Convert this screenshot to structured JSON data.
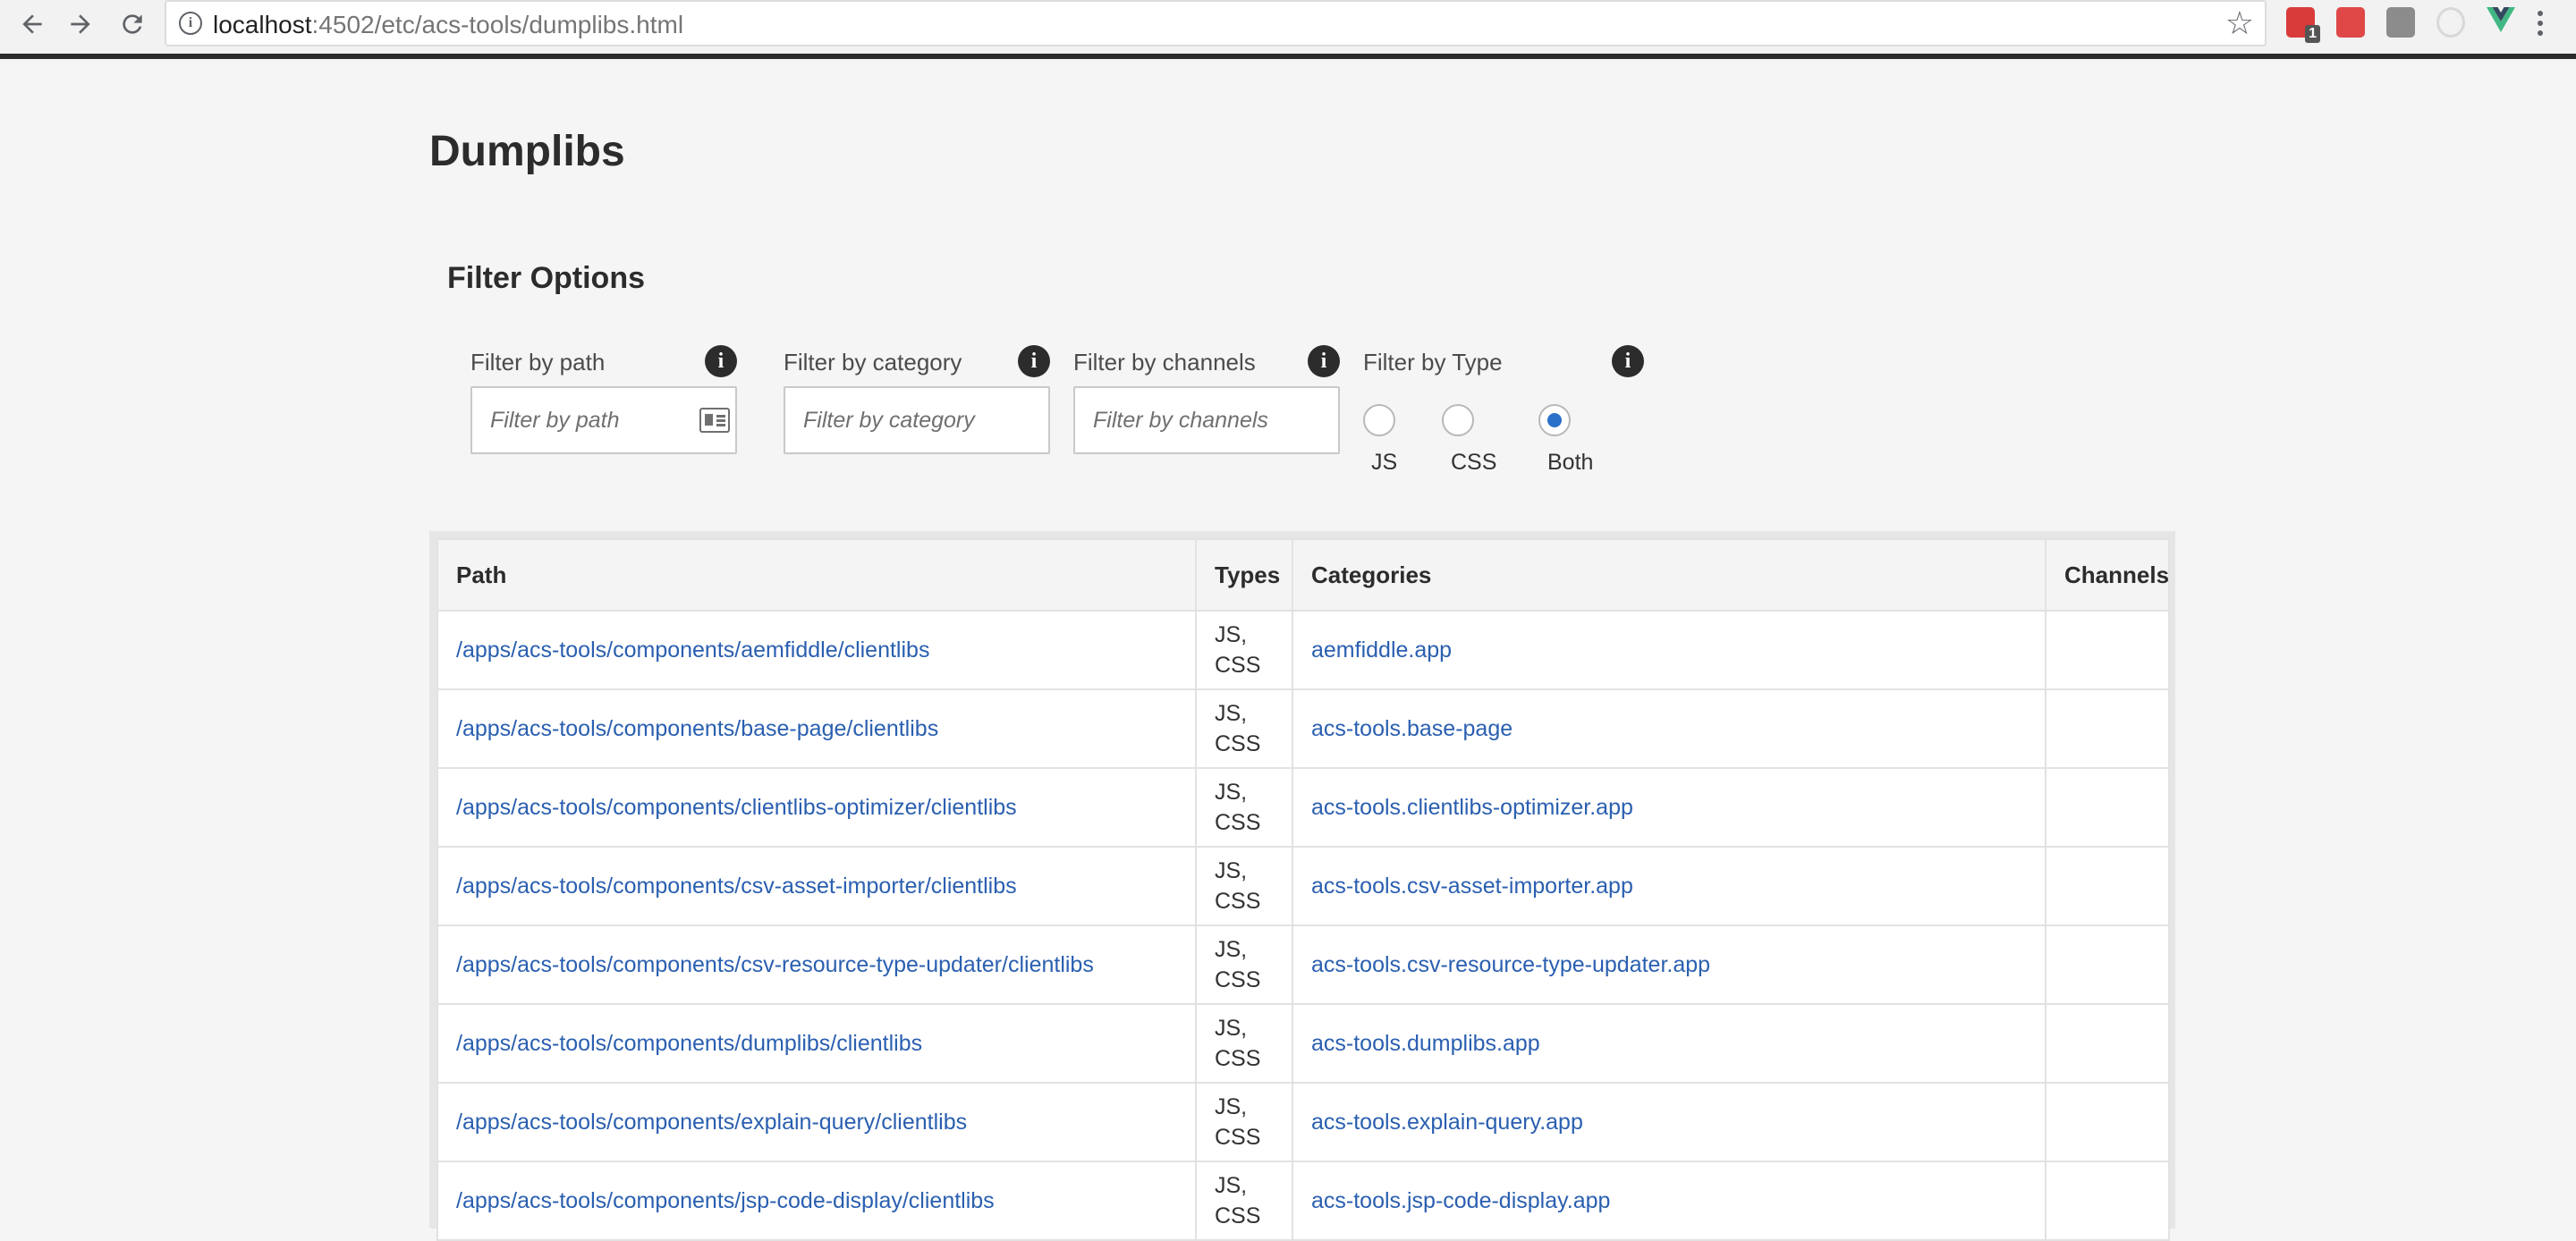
{
  "browser": {
    "url_host": "localhost",
    "url_rest": ":4502/etc/acs-tools/dumplibs.html",
    "extension_badge": "1"
  },
  "page": {
    "title": "Dumplibs",
    "filter_section_title": "Filter Options"
  },
  "filters": {
    "path": {
      "label": "Filter by path",
      "placeholder": "Filter by path"
    },
    "category": {
      "label": "Filter by category",
      "placeholder": "Filter by category"
    },
    "channels": {
      "label": "Filter by channels",
      "placeholder": "Filter by channels"
    },
    "type": {
      "label": "Filter by Type",
      "options": [
        "JS",
        "CSS",
        "Both"
      ],
      "selected": "Both"
    }
  },
  "table": {
    "headers": {
      "path": "Path",
      "types": "Types",
      "categories": "Categories",
      "channels": "Channels"
    },
    "rows": [
      {
        "path": "/apps/acs-tools/components/aemfiddle/clientlibs",
        "types_1": "JS,",
        "types_2": "CSS",
        "category": "aemfiddle.app",
        "channels": ""
      },
      {
        "path": "/apps/acs-tools/components/base-page/clientlibs",
        "types_1": "JS,",
        "types_2": "CSS",
        "category": "acs-tools.base-page",
        "channels": ""
      },
      {
        "path": "/apps/acs-tools/components/clientlibs-optimizer/clientlibs",
        "types_1": "JS,",
        "types_2": "CSS",
        "category": "acs-tools.clientlibs-optimizer.app",
        "channels": ""
      },
      {
        "path": "/apps/acs-tools/components/csv-asset-importer/clientlibs",
        "types_1": "JS,",
        "types_2": "CSS",
        "category": "acs-tools.csv-asset-importer.app",
        "channels": ""
      },
      {
        "path": "/apps/acs-tools/components/csv-resource-type-updater/clientlibs",
        "types_1": "JS,",
        "types_2": "CSS",
        "category": "acs-tools.csv-resource-type-updater.app",
        "channels": ""
      },
      {
        "path": "/apps/acs-tools/components/dumplibs/clientlibs",
        "types_1": "JS,",
        "types_2": "CSS",
        "category": "acs-tools.dumplibs.app",
        "channels": ""
      },
      {
        "path": "/apps/acs-tools/components/explain-query/clientlibs",
        "types_1": "JS,",
        "types_2": "CSS",
        "category": "acs-tools.explain-query.app",
        "channels": ""
      },
      {
        "path": "/apps/acs-tools/components/jsp-code-display/clientlibs",
        "types_1": "JS,",
        "types_2": "CSS",
        "category": "acs-tools.jsp-code-display.app",
        "channels": ""
      }
    ]
  },
  "colors": {
    "link": "#2a5fb0",
    "radio_selected": "#2b70c9",
    "page_bg": "#f5f5f5"
  }
}
